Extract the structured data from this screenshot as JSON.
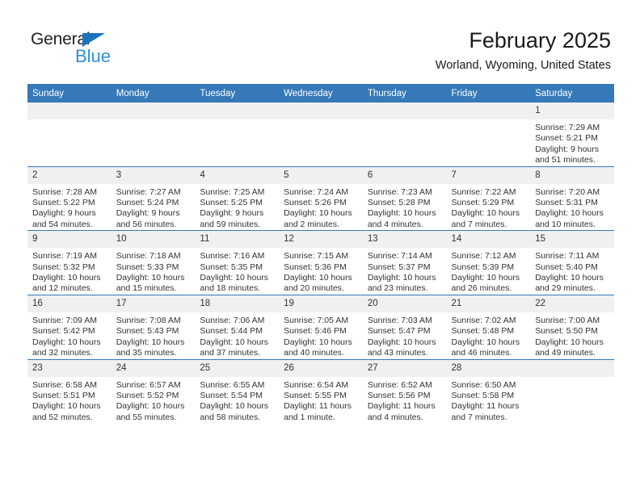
{
  "logo": {
    "word_one": "General",
    "word_two": "Blue",
    "flag_icon": "blue-flag-triangle",
    "colors": {
      "general": "#231f20",
      "blue": "#2e90d4",
      "flag": "#1b74bc"
    }
  },
  "header": {
    "title": "February 2025",
    "subtitle": "Worland, Wyoming, United States"
  },
  "theme": {
    "header_bg": "#3579b8",
    "header_text": "#ffffff",
    "daynum_bg": "#f0f0f0",
    "cell_text": "#333333",
    "row_divider": "#3579b8"
  },
  "calendar": {
    "weekday_headers": [
      "Sunday",
      "Monday",
      "Tuesday",
      "Wednesday",
      "Thursday",
      "Friday",
      "Saturday"
    ],
    "weeks": [
      [
        {
          "day": "",
          "lines": []
        },
        {
          "day": "",
          "lines": []
        },
        {
          "day": "",
          "lines": []
        },
        {
          "day": "",
          "lines": []
        },
        {
          "day": "",
          "lines": []
        },
        {
          "day": "",
          "lines": []
        },
        {
          "day": "1",
          "lines": [
            "Sunrise: 7:29 AM",
            "Sunset: 5:21 PM",
            "Daylight: 9 hours",
            "and 51 minutes."
          ]
        }
      ],
      [
        {
          "day": "2",
          "lines": [
            "Sunrise: 7:28 AM",
            "Sunset: 5:22 PM",
            "Daylight: 9 hours",
            "and 54 minutes."
          ]
        },
        {
          "day": "3",
          "lines": [
            "Sunrise: 7:27 AM",
            "Sunset: 5:24 PM",
            "Daylight: 9 hours",
            "and 56 minutes."
          ]
        },
        {
          "day": "4",
          "lines": [
            "Sunrise: 7:25 AM",
            "Sunset: 5:25 PM",
            "Daylight: 9 hours",
            "and 59 minutes."
          ]
        },
        {
          "day": "5",
          "lines": [
            "Sunrise: 7:24 AM",
            "Sunset: 5:26 PM",
            "Daylight: 10 hours",
            "and 2 minutes."
          ]
        },
        {
          "day": "6",
          "lines": [
            "Sunrise: 7:23 AM",
            "Sunset: 5:28 PM",
            "Daylight: 10 hours",
            "and 4 minutes."
          ]
        },
        {
          "day": "7",
          "lines": [
            "Sunrise: 7:22 AM",
            "Sunset: 5:29 PM",
            "Daylight: 10 hours",
            "and 7 minutes."
          ]
        },
        {
          "day": "8",
          "lines": [
            "Sunrise: 7:20 AM",
            "Sunset: 5:31 PM",
            "Daylight: 10 hours",
            "and 10 minutes."
          ]
        }
      ],
      [
        {
          "day": "9",
          "lines": [
            "Sunrise: 7:19 AM",
            "Sunset: 5:32 PM",
            "Daylight: 10 hours",
            "and 12 minutes."
          ]
        },
        {
          "day": "10",
          "lines": [
            "Sunrise: 7:18 AM",
            "Sunset: 5:33 PM",
            "Daylight: 10 hours",
            "and 15 minutes."
          ]
        },
        {
          "day": "11",
          "lines": [
            "Sunrise: 7:16 AM",
            "Sunset: 5:35 PM",
            "Daylight: 10 hours",
            "and 18 minutes."
          ]
        },
        {
          "day": "12",
          "lines": [
            "Sunrise: 7:15 AM",
            "Sunset: 5:36 PM",
            "Daylight: 10 hours",
            "and 20 minutes."
          ]
        },
        {
          "day": "13",
          "lines": [
            "Sunrise: 7:14 AM",
            "Sunset: 5:37 PM",
            "Daylight: 10 hours",
            "and 23 minutes."
          ]
        },
        {
          "day": "14",
          "lines": [
            "Sunrise: 7:12 AM",
            "Sunset: 5:39 PM",
            "Daylight: 10 hours",
            "and 26 minutes."
          ]
        },
        {
          "day": "15",
          "lines": [
            "Sunrise: 7:11 AM",
            "Sunset: 5:40 PM",
            "Daylight: 10 hours",
            "and 29 minutes."
          ]
        }
      ],
      [
        {
          "day": "16",
          "lines": [
            "Sunrise: 7:09 AM",
            "Sunset: 5:42 PM",
            "Daylight: 10 hours",
            "and 32 minutes."
          ]
        },
        {
          "day": "17",
          "lines": [
            "Sunrise: 7:08 AM",
            "Sunset: 5:43 PM",
            "Daylight: 10 hours",
            "and 35 minutes."
          ]
        },
        {
          "day": "18",
          "lines": [
            "Sunrise: 7:06 AM",
            "Sunset: 5:44 PM",
            "Daylight: 10 hours",
            "and 37 minutes."
          ]
        },
        {
          "day": "19",
          "lines": [
            "Sunrise: 7:05 AM",
            "Sunset: 5:46 PM",
            "Daylight: 10 hours",
            "and 40 minutes."
          ]
        },
        {
          "day": "20",
          "lines": [
            "Sunrise: 7:03 AM",
            "Sunset: 5:47 PM",
            "Daylight: 10 hours",
            "and 43 minutes."
          ]
        },
        {
          "day": "21",
          "lines": [
            "Sunrise: 7:02 AM",
            "Sunset: 5:48 PM",
            "Daylight: 10 hours",
            "and 46 minutes."
          ]
        },
        {
          "day": "22",
          "lines": [
            "Sunrise: 7:00 AM",
            "Sunset: 5:50 PM",
            "Daylight: 10 hours",
            "and 49 minutes."
          ]
        }
      ],
      [
        {
          "day": "23",
          "lines": [
            "Sunrise: 6:58 AM",
            "Sunset: 5:51 PM",
            "Daylight: 10 hours",
            "and 52 minutes."
          ]
        },
        {
          "day": "24",
          "lines": [
            "Sunrise: 6:57 AM",
            "Sunset: 5:52 PM",
            "Daylight: 10 hours",
            "and 55 minutes."
          ]
        },
        {
          "day": "25",
          "lines": [
            "Sunrise: 6:55 AM",
            "Sunset: 5:54 PM",
            "Daylight: 10 hours",
            "and 58 minutes."
          ]
        },
        {
          "day": "26",
          "lines": [
            "Sunrise: 6:54 AM",
            "Sunset: 5:55 PM",
            "Daylight: 11 hours",
            "and 1 minute."
          ]
        },
        {
          "day": "27",
          "lines": [
            "Sunrise: 6:52 AM",
            "Sunset: 5:56 PM",
            "Daylight: 11 hours",
            "and 4 minutes."
          ]
        },
        {
          "day": "28",
          "lines": [
            "Sunrise: 6:50 AM",
            "Sunset: 5:58 PM",
            "Daylight: 11 hours",
            "and 7 minutes."
          ]
        },
        {
          "day": "",
          "lines": []
        }
      ]
    ]
  }
}
